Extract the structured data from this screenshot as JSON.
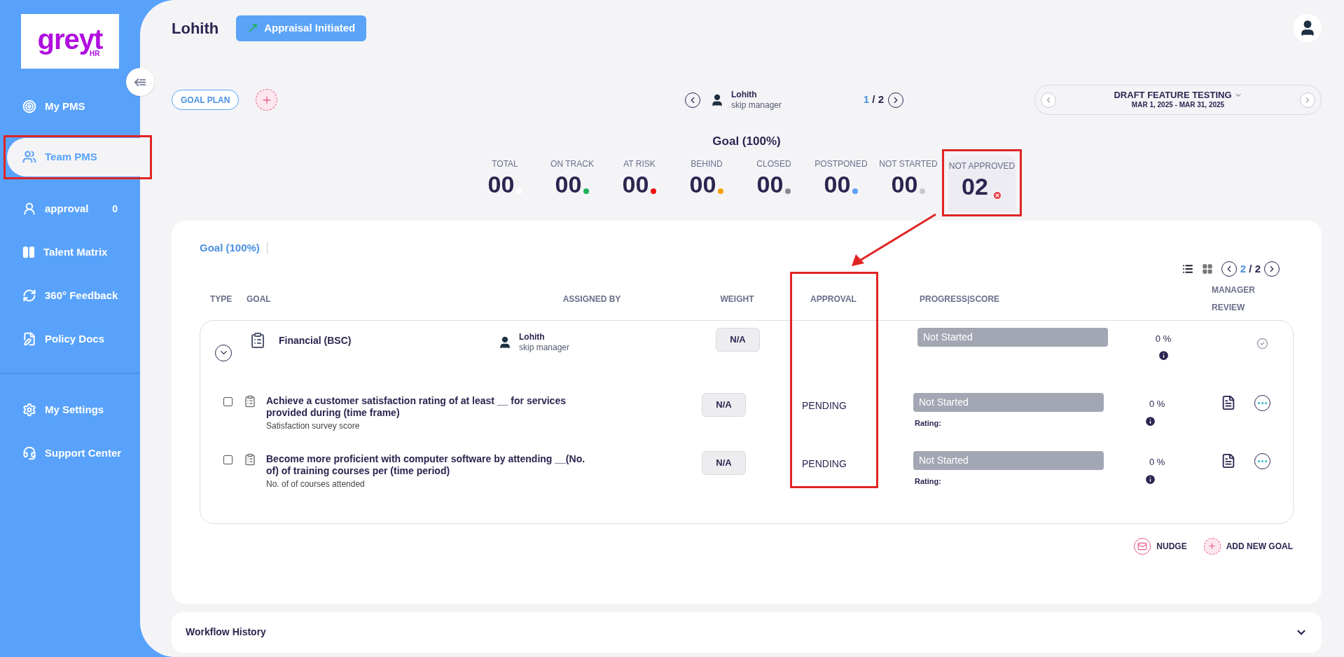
{
  "logo": {
    "word": "greyt",
    "suffix": "HR"
  },
  "sidebar": {
    "items": [
      {
        "label": "My PMS",
        "kind": "target",
        "selected": false,
        "highlighted": false
      },
      {
        "label": "Team PMS",
        "kind": "team",
        "selected": true,
        "highlighted": true
      },
      {
        "label": "approval",
        "kind": "person",
        "selected": false,
        "highlighted": false,
        "count": "0"
      },
      {
        "label": "Talent Matrix",
        "kind": "matrix",
        "selected": false,
        "highlighted": false
      },
      {
        "label": "360° Feedback",
        "kind": "feedback",
        "selected": false,
        "highlighted": false
      },
      {
        "label": "Policy Docs",
        "kind": "docs",
        "selected": false,
        "highlighted": false
      }
    ],
    "bottom_items": [
      {
        "label": "My Settings",
        "kind": "settings",
        "selected": false
      },
      {
        "label": "Support Center",
        "kind": "support",
        "selected": false
      }
    ]
  },
  "header": {
    "name": "Lohith",
    "status": "Appraisal Initiated"
  },
  "toolbar": {
    "goal_plan": "GOAL PLAN",
    "reviewer": {
      "name": "Lohith",
      "role": "skip manager"
    },
    "pager": {
      "current": "1",
      "rest": "/ 2"
    },
    "cycle": {
      "name": "DRAFT FEATURE TESTING",
      "dates": "MAR 1, 2025 - MAR 31, 2025"
    }
  },
  "summary": {
    "title": "Goal (100%)",
    "stats": [
      {
        "label": "TOTAL",
        "value": "00",
        "kind": "dot",
        "color": "#ffffff",
        "highlighted": false
      },
      {
        "label": "ON TRACK",
        "value": "00",
        "kind": "dot",
        "color": "#1fb35b",
        "highlighted": false
      },
      {
        "label": "AT RISK",
        "value": "00",
        "kind": "dot",
        "color": "#ee1111",
        "highlighted": false
      },
      {
        "label": "BEHIND",
        "value": "00",
        "kind": "dot",
        "color": "#f5a00b",
        "highlighted": false
      },
      {
        "label": "CLOSED",
        "value": "00",
        "kind": "dot",
        "color": "#8a8a95",
        "highlighted": false
      },
      {
        "label": "POSTPONED",
        "value": "00",
        "kind": "dot",
        "color": "#5aa3f8",
        "highlighted": false
      },
      {
        "label": "NOT STARTED",
        "value": "00",
        "kind": "dot",
        "color": "#c8c8d0",
        "highlighted": false
      },
      {
        "label": "NOT APPROVED",
        "value": "02",
        "kind": "error",
        "color": "#e5484d",
        "highlighted": true
      }
    ]
  },
  "goals_card": {
    "tabs": [
      {
        "label": "Goal (100%)",
        "selected": true
      }
    ],
    "views": [
      {
        "kind": "list",
        "selected": true
      },
      {
        "kind": "grid",
        "selected": false
      }
    ],
    "pager": {
      "current": "2",
      "rest": "/ 2"
    },
    "columns": [
      {
        "label": "TYPE",
        "highlighted": false
      },
      {
        "label": "GOAL",
        "highlighted": false
      },
      {
        "label": "ASSIGNED BY",
        "highlighted": false
      },
      {
        "label": "WEIGHT",
        "highlighted": false
      },
      {
        "label": "APPROVAL",
        "highlighted": true
      },
      {
        "label": "PROGRESS|SCORE",
        "highlighted": false
      },
      {
        "label": "MANAGER REVIEW",
        "highlighted": false
      }
    ],
    "group": {
      "expanded": true,
      "name": "Financial (BSC)",
      "assigned_by": {
        "name": "Lohith",
        "role": "skip manager"
      },
      "weight": "N/A",
      "progress": "Not Started",
      "score": "0 %"
    },
    "rows": [
      {
        "checked": false,
        "title": "Achieve a customer satisfaction rating of at least __ for services provided during (time frame)",
        "measure": "Satisfaction survey score",
        "weight": "N/A",
        "approval": "PENDING",
        "progress": "Not Started",
        "rating_label": "Rating:",
        "score": "0 %"
      },
      {
        "checked": false,
        "title": "Become more proficient with computer software by attending __(No. of) of training courses per (time period)",
        "measure": "No. of of courses attended",
        "weight": "N/A",
        "approval": "PENDING",
        "progress": "Not Started",
        "rating_label": "Rating:",
        "score": "0 %"
      }
    ],
    "actions": [
      {
        "kind": "nudge",
        "label": "NUDGE"
      },
      {
        "kind": "add",
        "label": "ADD NEW GOAL"
      }
    ]
  },
  "workflow": {
    "title": "Workflow History",
    "expanded": false
  }
}
